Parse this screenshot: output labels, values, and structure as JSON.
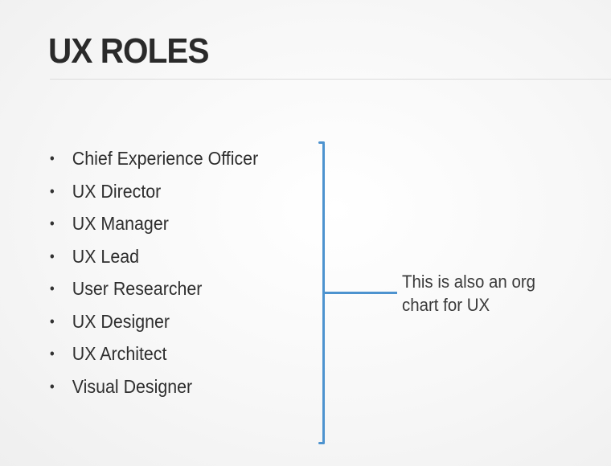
{
  "slide": {
    "title": "UX ROLES",
    "roles": [
      "Chief Experience Officer",
      "UX Director",
      "UX Manager",
      "UX Lead",
      "User Researcher",
      "UX Designer",
      "UX Architect",
      "Visual Designer"
    ],
    "bullet": "•",
    "callout_text": "This is also an org chart for UX",
    "colors": {
      "bracket": "#4d93cf",
      "text": "#2e2e2e",
      "title": "#2a2a2a"
    }
  }
}
